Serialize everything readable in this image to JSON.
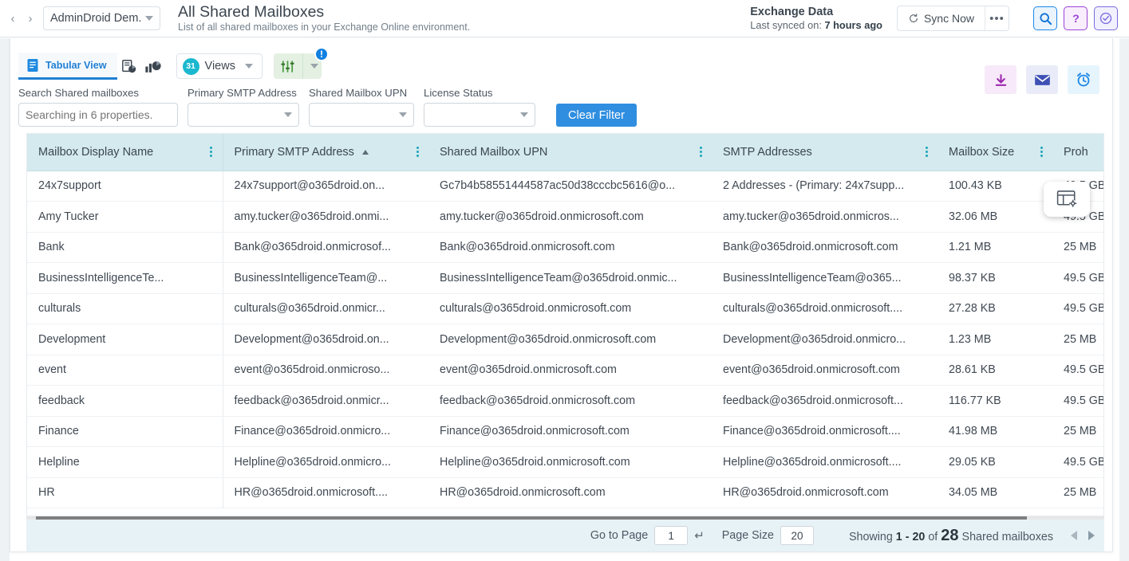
{
  "topbar": {
    "nav_back": "‹",
    "nav_forward": "›",
    "tenant_name": "AdminDroid Dem...",
    "page_title": "All Shared Mailboxes",
    "page_subtitle": "List of all shared mailboxes in your Exchange Online environment.",
    "sync_title": "Exchange Data",
    "sync_prefix": "Last synced on:",
    "sync_value": "7 hours ago",
    "sync_now_label": "Sync Now",
    "more_label": "•••"
  },
  "toolbar": {
    "tab_label": "Tabular View",
    "views_count": "31",
    "views_label": "Views",
    "filter_alert_badge": "!"
  },
  "filters": {
    "search_label": "Search Shared mailboxes",
    "search_placeholder": "Searching in 6 properties.",
    "search_value": "",
    "primary_smtp_label": "Primary SMTP Address",
    "primary_smtp_value": "",
    "upn_label": "Shared Mailbox UPN",
    "upn_value": "",
    "license_label": "License Status",
    "license_value": "",
    "clear_filter_label": "Clear Filter"
  },
  "table": {
    "columns": [
      {
        "label": "Mailbox Display Name",
        "sorted": false
      },
      {
        "label": "Primary SMTP Address",
        "sorted": true
      },
      {
        "label": "Shared Mailbox UPN",
        "sorted": false
      },
      {
        "label": "SMTP Addresses",
        "sorted": false
      },
      {
        "label": "Mailbox Size",
        "sorted": false
      },
      {
        "label": "Proh",
        "sorted": false
      }
    ],
    "rows": [
      {
        "display_name": "24x7support",
        "primary_smtp": "24x7support@o365droid.on...",
        "upn": "Gc7b4b58551444587ac50d38cccbc5616@o...",
        "smtp_addresses": "2 Addresses - (Primary: 24x7supp...",
        "mailbox_size": "100.43 KB",
        "prohibit": "49.5 GB"
      },
      {
        "display_name": "Amy Tucker",
        "primary_smtp": "amy.tucker@o365droid.onmi...",
        "upn": "amy.tucker@o365droid.onmicrosoft.com",
        "smtp_addresses": "amy.tucker@o365droid.onmicros...",
        "mailbox_size": "32.06 MB",
        "prohibit": "49.5 GB"
      },
      {
        "display_name": "Bank",
        "primary_smtp": "Bank@o365droid.onmicrosof...",
        "upn": "Bank@o365droid.onmicrosoft.com",
        "smtp_addresses": "Bank@o365droid.onmicrosoft.com",
        "mailbox_size": "1.21 MB",
        "prohibit": "25 MB"
      },
      {
        "display_name": "BusinessIntelligenceTe...",
        "primary_smtp": "BusinessIntelligenceTeam@...",
        "upn": "BusinessIntelligenceTeam@o365droid.onmic...",
        "smtp_addresses": "BusinessIntelligenceTeam@o365...",
        "mailbox_size": "98.37 KB",
        "prohibit": "49.5 GB"
      },
      {
        "display_name": "culturals",
        "primary_smtp": "culturals@o365droid.onmicr...",
        "upn": "culturals@o365droid.onmicrosoft.com",
        "smtp_addresses": "culturals@o365droid.onmicrosoft....",
        "mailbox_size": "27.28 KB",
        "prohibit": "49.5 GB"
      },
      {
        "display_name": "Development",
        "primary_smtp": "Development@o365droid.on...",
        "upn": "Development@o365droid.onmicrosoft.com",
        "smtp_addresses": "Development@o365droid.onmicro...",
        "mailbox_size": "1.23 MB",
        "prohibit": "25 MB"
      },
      {
        "display_name": "event",
        "primary_smtp": "event@o365droid.onmicroso...",
        "upn": "event@o365droid.onmicrosoft.com",
        "smtp_addresses": "event@o365droid.onmicrosoft.com",
        "mailbox_size": "28.61 KB",
        "prohibit": "49.5 GB"
      },
      {
        "display_name": "feedback",
        "primary_smtp": "feedback@o365droid.onmicr...",
        "upn": "feedback@o365droid.onmicrosoft.com",
        "smtp_addresses": "feedback@o365droid.onmicrosoft...",
        "mailbox_size": "116.77 KB",
        "prohibit": "49.5 GB"
      },
      {
        "display_name": "Finance",
        "primary_smtp": "Finance@o365droid.onmicro...",
        "upn": "Finance@o365droid.onmicrosoft.com",
        "smtp_addresses": "Finance@o365droid.onmicrosoft....",
        "mailbox_size": "41.98 MB",
        "prohibit": "25 MB"
      },
      {
        "display_name": "Helpline",
        "primary_smtp": "Helpline@o365droid.onmicro...",
        "upn": "Helpline@o365droid.onmicrosoft.com",
        "smtp_addresses": "Helpline@o365droid.onmicrosoft....",
        "mailbox_size": "29.05 KB",
        "prohibit": "49.5 GB"
      },
      {
        "display_name": "HR",
        "primary_smtp": "HR@o365droid.onmicrosoft....",
        "upn": "HR@o365droid.onmicrosoft.com",
        "smtp_addresses": "HR@o365droid.onmicrosoft.com",
        "mailbox_size": "34.05 MB",
        "prohibit": "25 MB"
      }
    ]
  },
  "pagination": {
    "goto_label": "Go to Page",
    "page_value": "1",
    "enter_glyph": "↵",
    "page_size_label": "Page Size",
    "page_size_value": "20",
    "showing_label": "Showing",
    "range": "1 - 20",
    "of_label": "of",
    "total": "28",
    "entity_label": "Shared mailboxes"
  },
  "colors": {
    "accent_blue": "#1f7fd4",
    "header_teal": "#d4eaef",
    "badge_teal": "#1bb8cf",
    "clear_filter_blue": "#2f8ee0",
    "footer_blue": "#e7f2f7"
  }
}
